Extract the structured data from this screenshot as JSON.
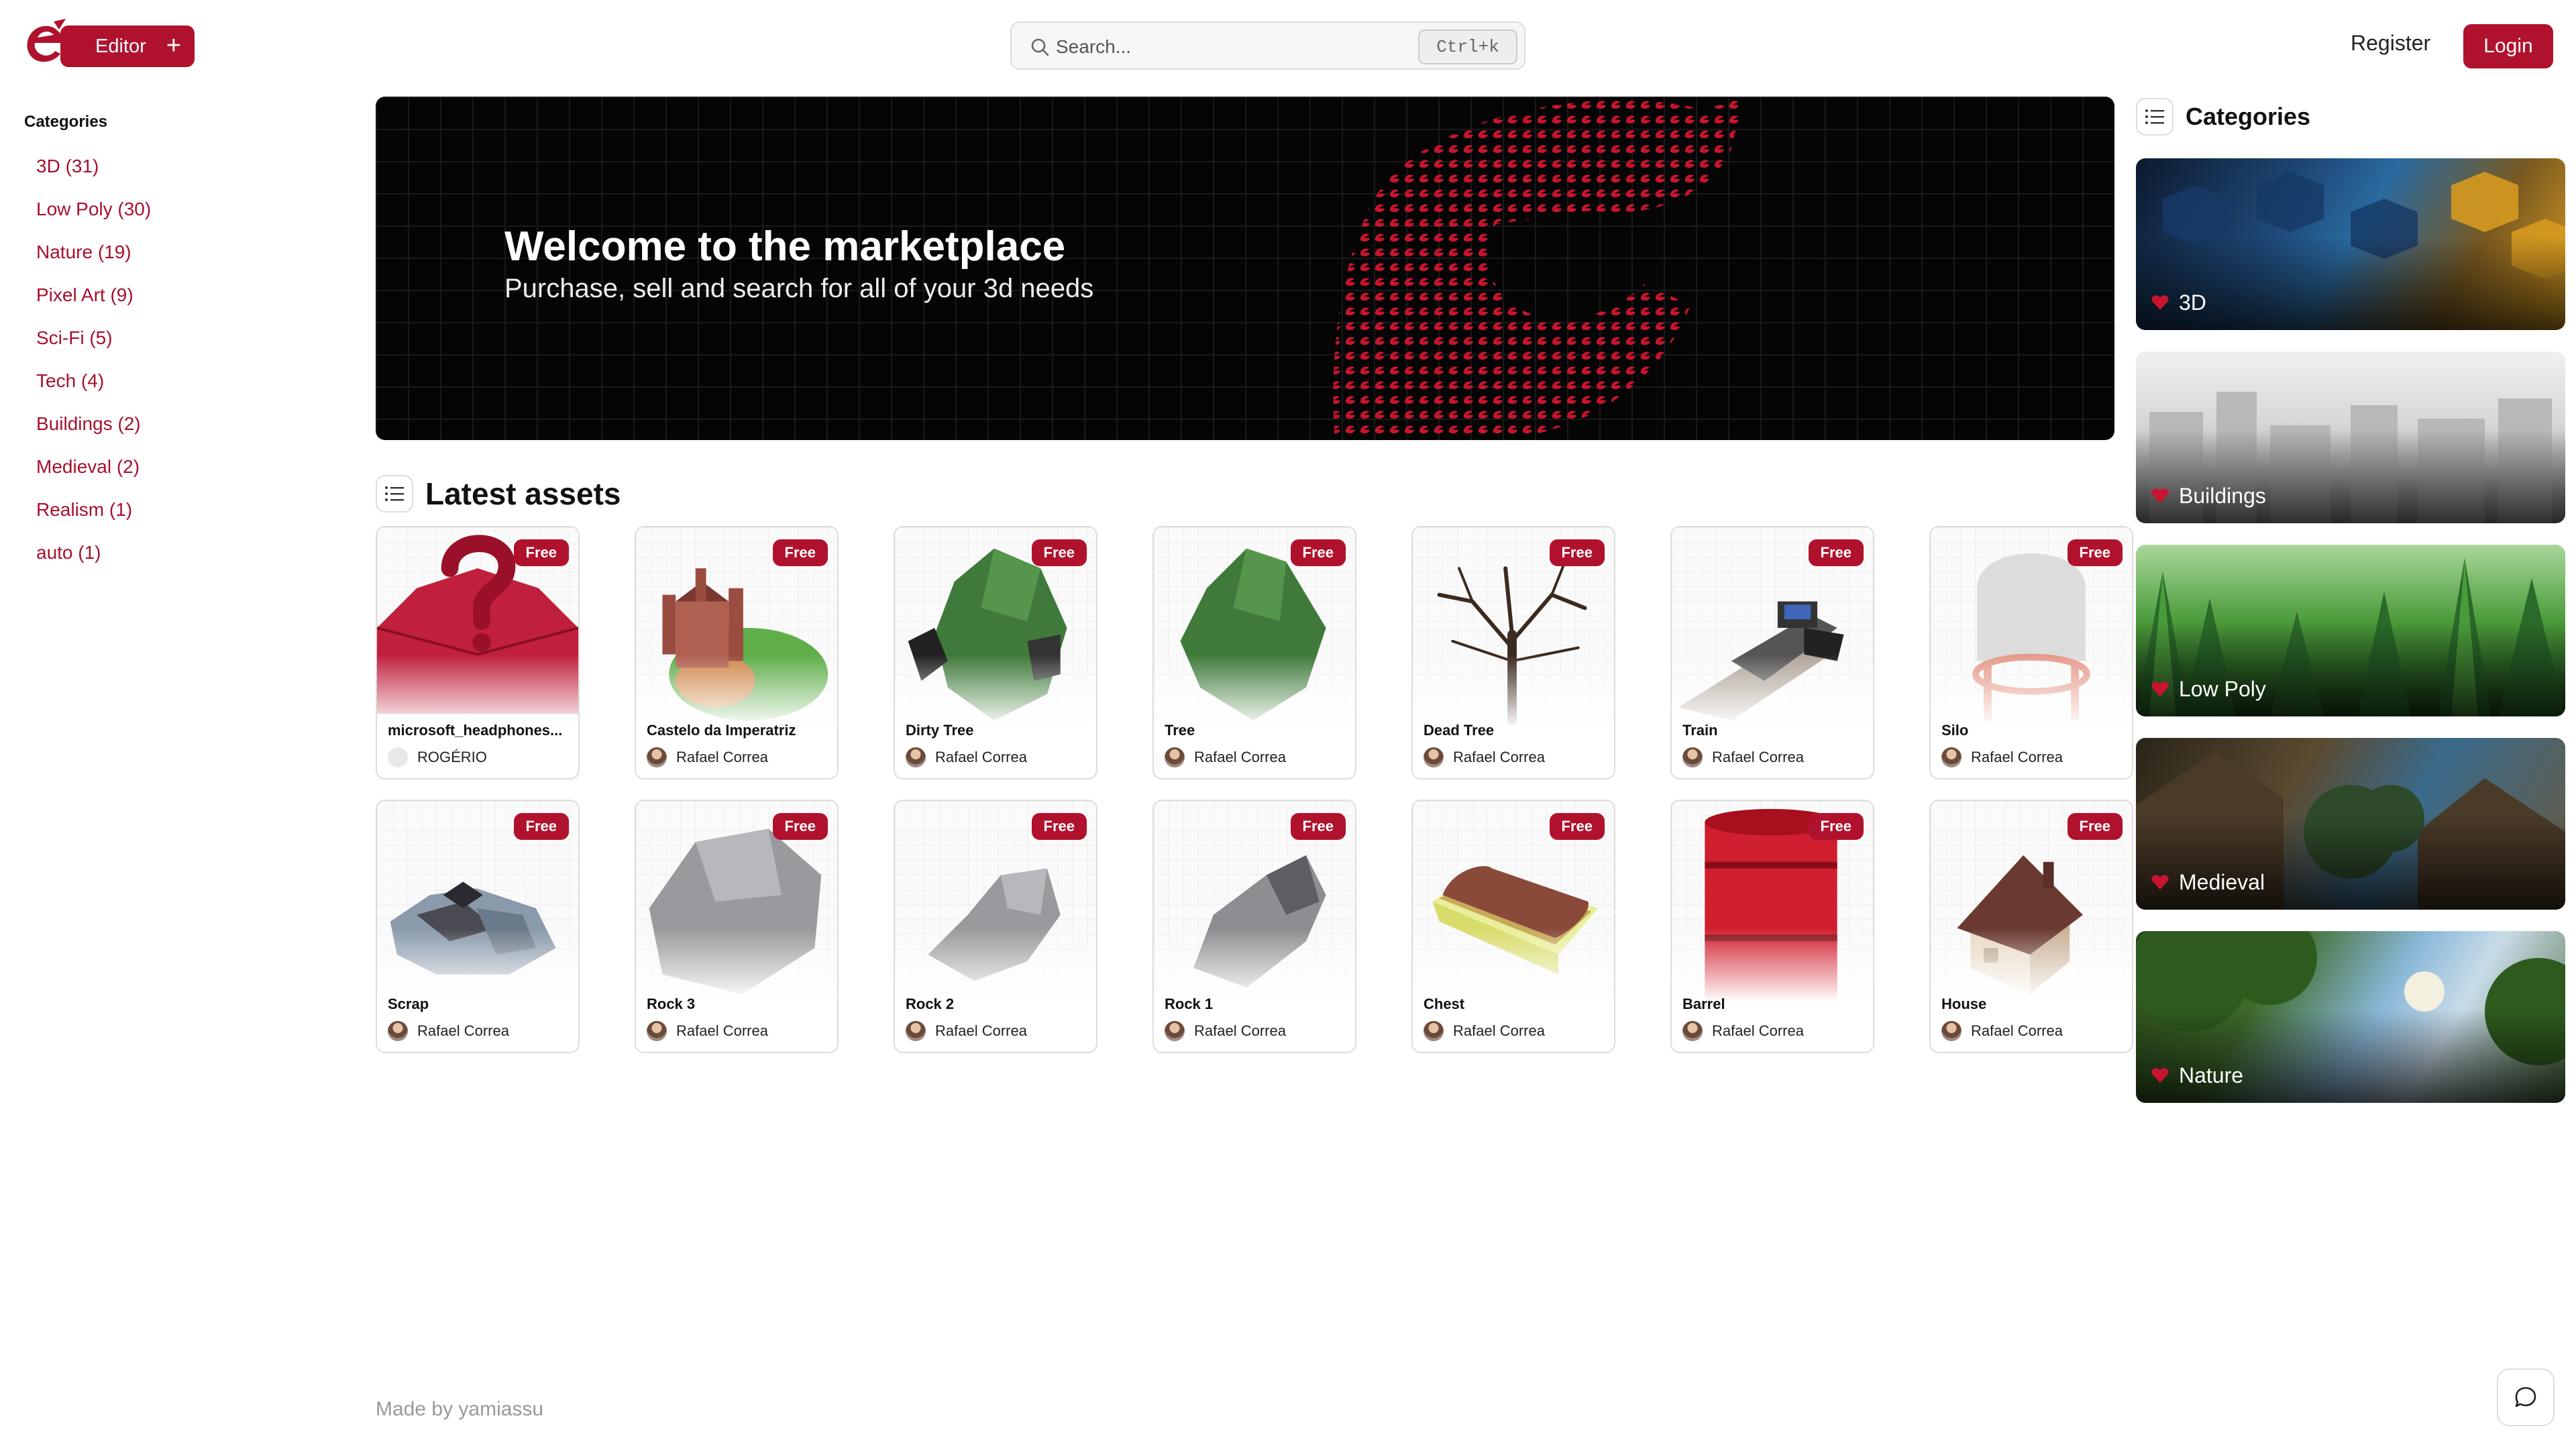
{
  "header": {
    "editor_label": "Editor",
    "editor_plus": "+",
    "search_placeholder": "Search...",
    "search_shortcut": "Ctrl+k",
    "register_label": "Register",
    "login_label": "Login"
  },
  "left_sidebar": {
    "title": "Categories",
    "items": [
      "3D (31)",
      "Low Poly (30)",
      "Nature (19)",
      "Pixel Art (9)",
      "Sci-Fi (5)",
      "Tech (4)",
      "Buildings (2)",
      "Medieval (2)",
      "Realism (1)",
      "auto (1)"
    ]
  },
  "banner": {
    "title": "Welcome to the marketplace",
    "subtitle": "Purchase, sell and search for all of your 3d needs"
  },
  "latest": {
    "title": "Latest assets",
    "assets": [
      {
        "name": "microsoft_headphones...",
        "author": "ROGÉRIO",
        "badge": "Free"
      },
      {
        "name": "Castelo da Imperatriz",
        "author": "Rafael Correa",
        "badge": "Free"
      },
      {
        "name": "Dirty Tree",
        "author": "Rafael Correa",
        "badge": "Free"
      },
      {
        "name": "Tree",
        "author": "Rafael Correa",
        "badge": "Free"
      },
      {
        "name": "Dead Tree",
        "author": "Rafael Correa",
        "badge": "Free"
      },
      {
        "name": "Train",
        "author": "Rafael Correa",
        "badge": "Free"
      },
      {
        "name": "Silo",
        "author": "Rafael Correa",
        "badge": "Free"
      },
      {
        "name": "Scrap",
        "author": "Rafael Correa",
        "badge": "Free"
      },
      {
        "name": "Rock 3",
        "author": "Rafael Correa",
        "badge": "Free"
      },
      {
        "name": "Rock 2",
        "author": "Rafael Correa",
        "badge": "Free"
      },
      {
        "name": "Rock 1",
        "author": "Rafael Correa",
        "badge": "Free"
      },
      {
        "name": "Chest",
        "author": "Rafael Correa",
        "badge": "Free"
      },
      {
        "name": "Barrel",
        "author": "Rafael Correa",
        "badge": "Free"
      },
      {
        "name": "House",
        "author": "Rafael Correa",
        "badge": "Free"
      }
    ]
  },
  "right_sidebar": {
    "title": "Categories",
    "cards": [
      "3D",
      "Buildings",
      "Low Poly",
      "Medieval",
      "Nature"
    ]
  },
  "footer": {
    "text": "Made by yamiassu"
  },
  "colors": {
    "accent": "#b0122e",
    "link": "#a8102c"
  }
}
